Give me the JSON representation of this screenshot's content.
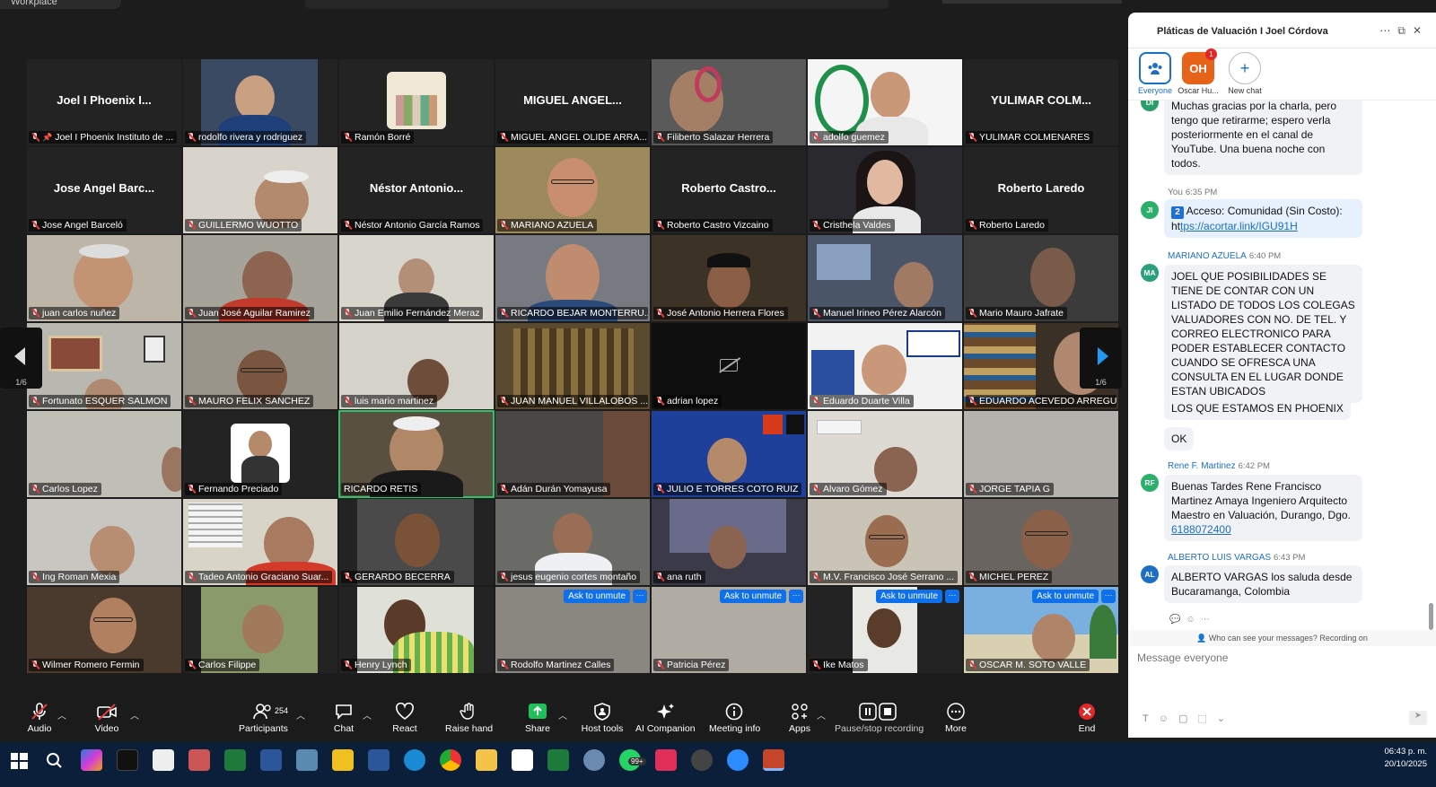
{
  "top": {
    "workspace_label": "Workplace"
  },
  "grid": {
    "tiles": [
      {
        "label": "Joel I Phoenix Instituto de ...",
        "big": "Joel I Phoenix I..."
      },
      {
        "label": "rodolfo rivera y rodriguez"
      },
      {
        "label": "Ramón Borré"
      },
      {
        "label": "MIGUEL ANGEL OLIDE ARRA...",
        "big": "MIGUEL ANGEL..."
      },
      {
        "label": "Filiberto Salazar Herrera"
      },
      {
        "label": "adolfo guemez"
      },
      {
        "label": "YULIMAR COLMENARES",
        "big": "YULIMAR COLM..."
      },
      {
        "label": "Jose Angel Barceló",
        "big": "Jose Angel Barc..."
      },
      {
        "label": "GUILLERMO WUOTTO"
      },
      {
        "label": "Néstor Antonio García Ramos",
        "big": "Néstor Antonio..."
      },
      {
        "label": "MARIANO AZUELA"
      },
      {
        "label": "Roberto Castro Vizcaino",
        "big": "Roberto Castro..."
      },
      {
        "label": "Cristhela Valdes"
      },
      {
        "label": "Roberto Laredo",
        "big": "Roberto Laredo"
      },
      {
        "label": "juan carlos nuñez"
      },
      {
        "label": "Juan José Aguilar Ramirez"
      },
      {
        "label": "Juan Emilio Fernández Meraz"
      },
      {
        "label": "RICARDO BEJAR MONTERRU..."
      },
      {
        "label": "José Antonio Herrera Flores"
      },
      {
        "label": "Manuel Irineo Pérez Alarcón"
      },
      {
        "label": "Mario Mauro Jafrate"
      },
      {
        "label": "Fortunato ESQUER SALMON"
      },
      {
        "label": "MAURO FELIX SANCHEZ"
      },
      {
        "label": "luis mario martinez"
      },
      {
        "label": "JUAN MANUEL VILLALOBOS ..."
      },
      {
        "label": "adrian lopez"
      },
      {
        "label": "Eduardo Duarte Villa"
      },
      {
        "label": "EDUARDO ACEVEDO ARREGU..."
      },
      {
        "label": "Carlos Lopez"
      },
      {
        "label": "Fernando Preciado"
      },
      {
        "label": "RICARDO RETIS"
      },
      {
        "label": "Adán Durán Yomayusa"
      },
      {
        "label": "JULIO E TORRES COTO RUIZ"
      },
      {
        "label": "Alvaro Gómez"
      },
      {
        "label": "JORGE TAPIA G"
      },
      {
        "label": "Ing Roman Mexia"
      },
      {
        "label": "Tadeo Antonio Graciano Suar..."
      },
      {
        "label": "GERARDO BECERRA"
      },
      {
        "label": "jesus eugenio cortes montaño"
      },
      {
        "label": "ana ruth"
      },
      {
        "label": "M.V. Francisco José Serrano ..."
      },
      {
        "label": "MICHEL PEREZ"
      },
      {
        "label": "Wilmer Romero Fermin"
      },
      {
        "label": "Carlos Filippe"
      },
      {
        "label": "Henry Lynch"
      },
      {
        "label": "Rodolfo Martinez Calles"
      },
      {
        "label": "Patricia Pérez"
      },
      {
        "label": "Ike Matos"
      },
      {
        "label": "OSCAR M. SOTO VALLE"
      }
    ],
    "ask_to_unmute": "Ask to unmute",
    "more_dots": "···",
    "page_indicator_left": "1/6",
    "page_indicator_right": "1/6"
  },
  "toolbar": {
    "audio": "Audio",
    "video": "Video",
    "participants": "Participants",
    "participants_count": "254",
    "chat": "Chat",
    "react": "React",
    "raise_hand": "Raise hand",
    "share": "Share",
    "host_tools": "Host tools",
    "ai_companion": "AI Companion",
    "meeting_info": "Meeting info",
    "apps": "Apps",
    "pause_stop_recording": "Pause/stop recording",
    "more": "More",
    "end": "End"
  },
  "chat": {
    "title": "Pláticas de Valuación I Joel Córdova",
    "chips": [
      {
        "label": "Everyone"
      },
      {
        "label": "Oscar Hu...",
        "initials": "OH",
        "badge": "1"
      },
      {
        "label": "New chat",
        "symbol": "+"
      }
    ],
    "messages": {
      "m0_avatar": "DI",
      "m0_text": "Muchas gracias por la charla, pero tengo que retirarme; espero verla posteriormente en el canal de YouTube. Una buena noche con todos.",
      "m1_sender": "You",
      "m1_time": "6:35 PM",
      "m1_avatar": "JI",
      "m1_num": "2",
      "m1_text": "Acceso: Comunidad (Sin Costo): ht",
      "m1_link": "tps://acortar.link/IGU91H",
      "m2_sender": "MARIANO AZUELA",
      "m2_time": "6:40 PM",
      "m2_avatar": "MA",
      "m2_text": "JOEL QUE POSIBILIDADES SE TIENE DE CONTAR CON UN LISTADO DE TODOS LOS COLEGAS VALUADORES CON NO. DE TEL. Y CORREO ELECTRONICO PARA PODER ESTABLECER CONTACTO CUANDO SE OFRESCA UNA CONSULTA EN EL LUGAR DONDE ESTAN UBICADOS",
      "m3_text": "LOS QUE ESTAMOS EN PHOENIX",
      "m4_text": "OK",
      "m5_sender": "Rene F. Martinez",
      "m5_time": "6:42 PM",
      "m5_avatar": "RF",
      "m5_text": "Buenas Tardes Rene Francisco Martinez Amaya Ingeniero Arquitecto Maestro en Valuación, Durango, Dgo.",
      "m5_link": "6188072400",
      "m6_sender": "ALBERTO LUIS VARGAS",
      "m6_time": "6:43 PM",
      "m6_avatar": "AL",
      "m6_text": "ALBERTO VARGAS los saluda desde Bucaramanga, Colombia"
    },
    "privacy": "Who can see your messages? Recording on",
    "input_placeholder": "Message everyone"
  },
  "taskbar": {
    "time": "06:43 p. m.",
    "date": "20/10/2025",
    "whatsapp_badge": "99+"
  },
  "colors": {
    "zoom_blue": "#0e71eb",
    "active_speaker": "#2cc36b",
    "share_green": "#1fbf5a",
    "end_red": "#e02828"
  }
}
